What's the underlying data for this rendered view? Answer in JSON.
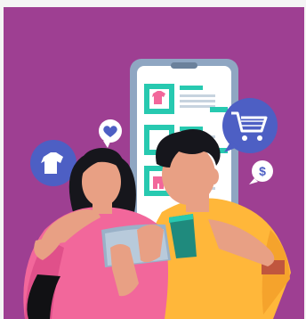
{
  "illustration": {
    "subject": "couple-online-shopping",
    "icons": [
      "tshirt-icon",
      "heart-icon",
      "shopping-cart-icon",
      "dollar-icon"
    ],
    "dollar_symbol": "$",
    "colors": {
      "background": "#9e3f92",
      "phone_frame": "#8fa6c2",
      "phone_screen": "#ffffff",
      "accent_teal": "#27c9b0",
      "bubble_blue": "#4d5fc4",
      "skin": "#e8a084",
      "hair": "#16161c",
      "woman_shirt": "#f2679b",
      "man_shirt": "#ffb73a",
      "tablet": "#9ab1c8",
      "cup": "#1f8a7d"
    }
  }
}
